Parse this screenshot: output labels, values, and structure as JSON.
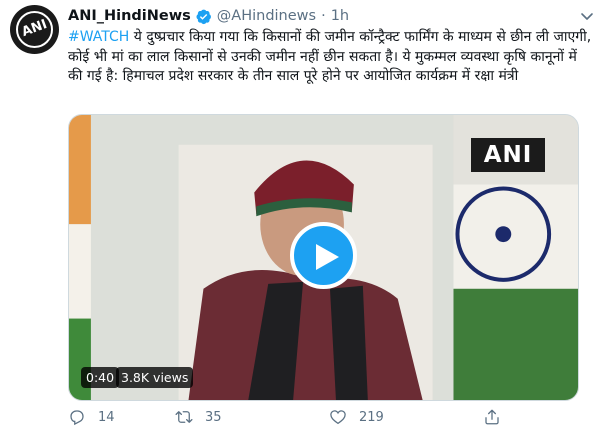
{
  "tweet": {
    "display_name": "ANI_HindiNews",
    "handle": "@AHindinews",
    "separator": "·",
    "time": "1h",
    "avatar_text": "ANI",
    "hashtag": "#WATCH",
    "text": " ये दुष्प्रचार किया गया कि किसानों की जमीन कॉन्ट्रैक्ट फार्मिंग के माध्यम से छीन ली जाएगी, कोई भी मां का लाल किसानों से उनकी जमीन नहीं छीन सकता है। ये मुकम्मल व्यवस्था कृषि कानूनों में की गई है: हिमाचल प्रदेश सरकार के तीन साल पूरे होने पर आयोजित कार्यक्रम में रक्षा मंत्री"
  },
  "media": {
    "watermark": "ANI",
    "duration": "0:40",
    "views": "3.8K views"
  },
  "actions": {
    "reply_count": "14",
    "retweet_count": "35",
    "like_count": "219"
  },
  "colors": {
    "accent": "#1da1f2",
    "secondary_text": "#5b7083",
    "verified": "#1da1f2"
  },
  "icons": {
    "verified": "verified-badge-icon",
    "menu": "chevron-down-icon",
    "play": "play-icon",
    "reply": "reply-icon",
    "retweet": "retweet-icon",
    "like": "heart-icon",
    "share": "share-icon"
  }
}
